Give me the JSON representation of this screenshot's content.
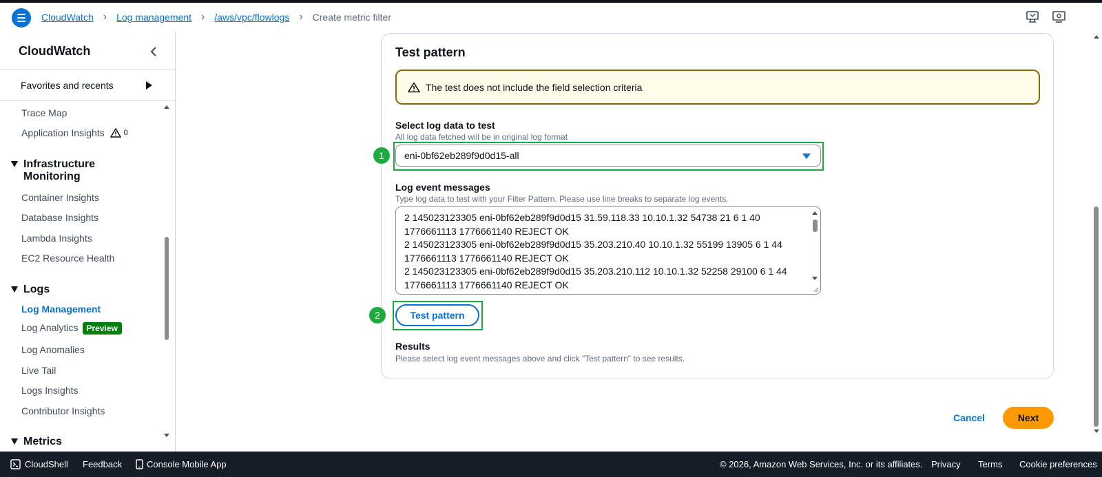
{
  "header": {
    "breadcrumb": [
      "CloudWatch",
      "Log management",
      "/aws/vpc/flowlogs"
    ],
    "breadcrumb_current": "Create metric filter"
  },
  "sidebar": {
    "title": "CloudWatch",
    "favorites": "Favorites and recents",
    "items_top": [
      "Trace Map",
      "Application Insights"
    ],
    "app_insights_count": "0",
    "infra_title_line1": "Infrastructure",
    "infra_title_line2": "Monitoring",
    "infra_items": [
      "Container Insights",
      "Database Insights",
      "Lambda Insights",
      "EC2 Resource Health"
    ],
    "logs_title": "Logs",
    "logs_items": [
      "Log Management",
      "Log Analytics",
      "Log Anomalies",
      "Live Tail",
      "Logs Insights",
      "Contributor Insights"
    ],
    "preview_badge": "Preview",
    "metrics_title": "Metrics"
  },
  "main": {
    "card_title": "Test pattern",
    "alert_text": "The test does not include the field selection criteria",
    "select_label": "Select log data to test",
    "select_desc": "All log data fetched will be in original log format",
    "select_value": "eni-0bf62eb289f9d0d15-all",
    "messages_label": "Log event messages",
    "messages_desc": "Type log data to test with your Filter Pattern. Please use line breaks to separate log events.",
    "messages": [
      "2 145023123305 eni-0bf62eb289f9d0d15 31.59.118.33 10.10.1.32 54738 21 6 1 40",
      "1776661113 1776661140 REJECT OK",
      "2 145023123305 eni-0bf62eb289f9d0d15 35.203.210.40 10.10.1.32 55199 13905 6 1 44",
      "1776661113 1776661140 REJECT OK",
      "2 145023123305 eni-0bf62eb289f9d0d15 35.203.210.112 10.10.1.32 52258 29100 6 1 44",
      "1776661113 1776661140 REJECT OK"
    ],
    "test_button": "Test pattern",
    "results_title": "Results",
    "results_desc": "Please select log event messages above and click \"Test pattern\" to see results.",
    "step1": "1",
    "step2": "2",
    "cancel": "Cancel",
    "next": "Next"
  },
  "footer": {
    "cloudshell": "CloudShell",
    "feedback": "Feedback",
    "mobile_app": "Console Mobile App",
    "copyright": "© 2026, Amazon Web Services, Inc. or its affiliates.",
    "privacy": "Privacy",
    "terms": "Terms",
    "cookies": "Cookie preferences"
  },
  "colors": {
    "link": "#0972d3",
    "primary_button": "#ff9900",
    "highlight": "#1dab3f",
    "footer_bg": "#161d26",
    "alert_border": "#8d6605"
  }
}
